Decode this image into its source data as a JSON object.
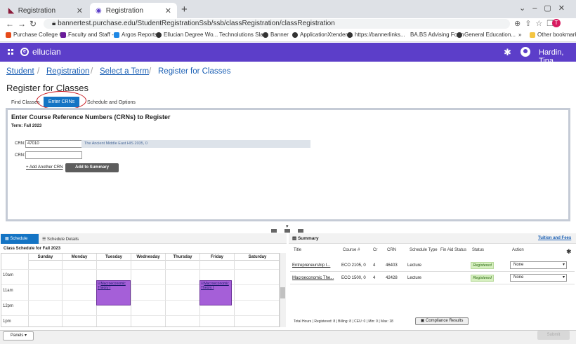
{
  "browser": {
    "tabs": [
      {
        "label": "Registration",
        "active": false
      },
      {
        "label": "Registration",
        "active": true
      }
    ],
    "url": "bannertest.purchase.edu/StudentRegistrationSsb/ssb/classRegistration/classRegistration",
    "profile_initial": "T",
    "bookmarks": [
      "Purchase College C...",
      "Faculty and Staff -...",
      "Argos Reports",
      "Ellucian Degree Wo...",
      "Technolutions Slate",
      "Banner",
      "ApplicationXtender:...",
      "https://bannerlinks...",
      "BA.BS Advising Form",
      "General Education...",
      "Other bookmarks"
    ]
  },
  "header": {
    "brand": "ellucian",
    "user": "Hardin, Tina"
  },
  "breadcrumb": [
    "Student",
    "Registration",
    "Select a Term",
    "Register for Classes"
  ],
  "page_title": "Register for Classes",
  "tabs": {
    "find": "Find Classes",
    "enter": "Enter CRNs",
    "schedule": "Schedule and Options"
  },
  "crn_panel": {
    "heading": "Enter Course Reference Numbers (CRNs) to Register",
    "term": "Term: Fall 2023",
    "crn_label": "CRN:",
    "crn1_value": "47010",
    "crn1_hint": "The Ancient Middle East HIS 2035, 0",
    "crn2_value": "",
    "add_another": "+ Add Another CRN",
    "add_to_summary": "Add to Summary"
  },
  "schedule": {
    "tab_schedule": "Schedule",
    "tab_details": "Schedule Details",
    "title": "Class Schedule for Fall 2023",
    "days": [
      "Sunday",
      "Monday",
      "Tuesday",
      "Wednesday",
      "Thursday",
      "Friday",
      "Saturday"
    ],
    "hours": [
      "10am",
      "11am",
      "12pm",
      "1pm"
    ],
    "event_label": "Macroeconomic Theory I"
  },
  "summary": {
    "title": "Summary",
    "tuition_link": "Tuition and Fees",
    "columns": [
      "Title",
      "Course #",
      "Cr",
      "CRN",
      "Schedule Type",
      "Fin Aid Status",
      "Status",
      "Action"
    ],
    "rows": [
      {
        "title": "Entrepreneurship I...",
        "course": "ECO 2105, 0",
        "cr": "4",
        "crn": "46403",
        "type": "Lecture",
        "status": "Registered",
        "action": "None"
      },
      {
        "title": "Macroeconomic The...",
        "course": "ECO 1500, 0",
        "cr": "4",
        "crn": "42428",
        "type": "Lecture",
        "status": "Registered",
        "action": "None"
      }
    ],
    "totals": "Total Hours | Registered: 8 | Billing: 8 | CEU: 0 | Min: 0 | Max: 18",
    "compliance_button": "Compliance Results"
  },
  "footer": {
    "panels": "Panels",
    "submit": "Submit"
  }
}
